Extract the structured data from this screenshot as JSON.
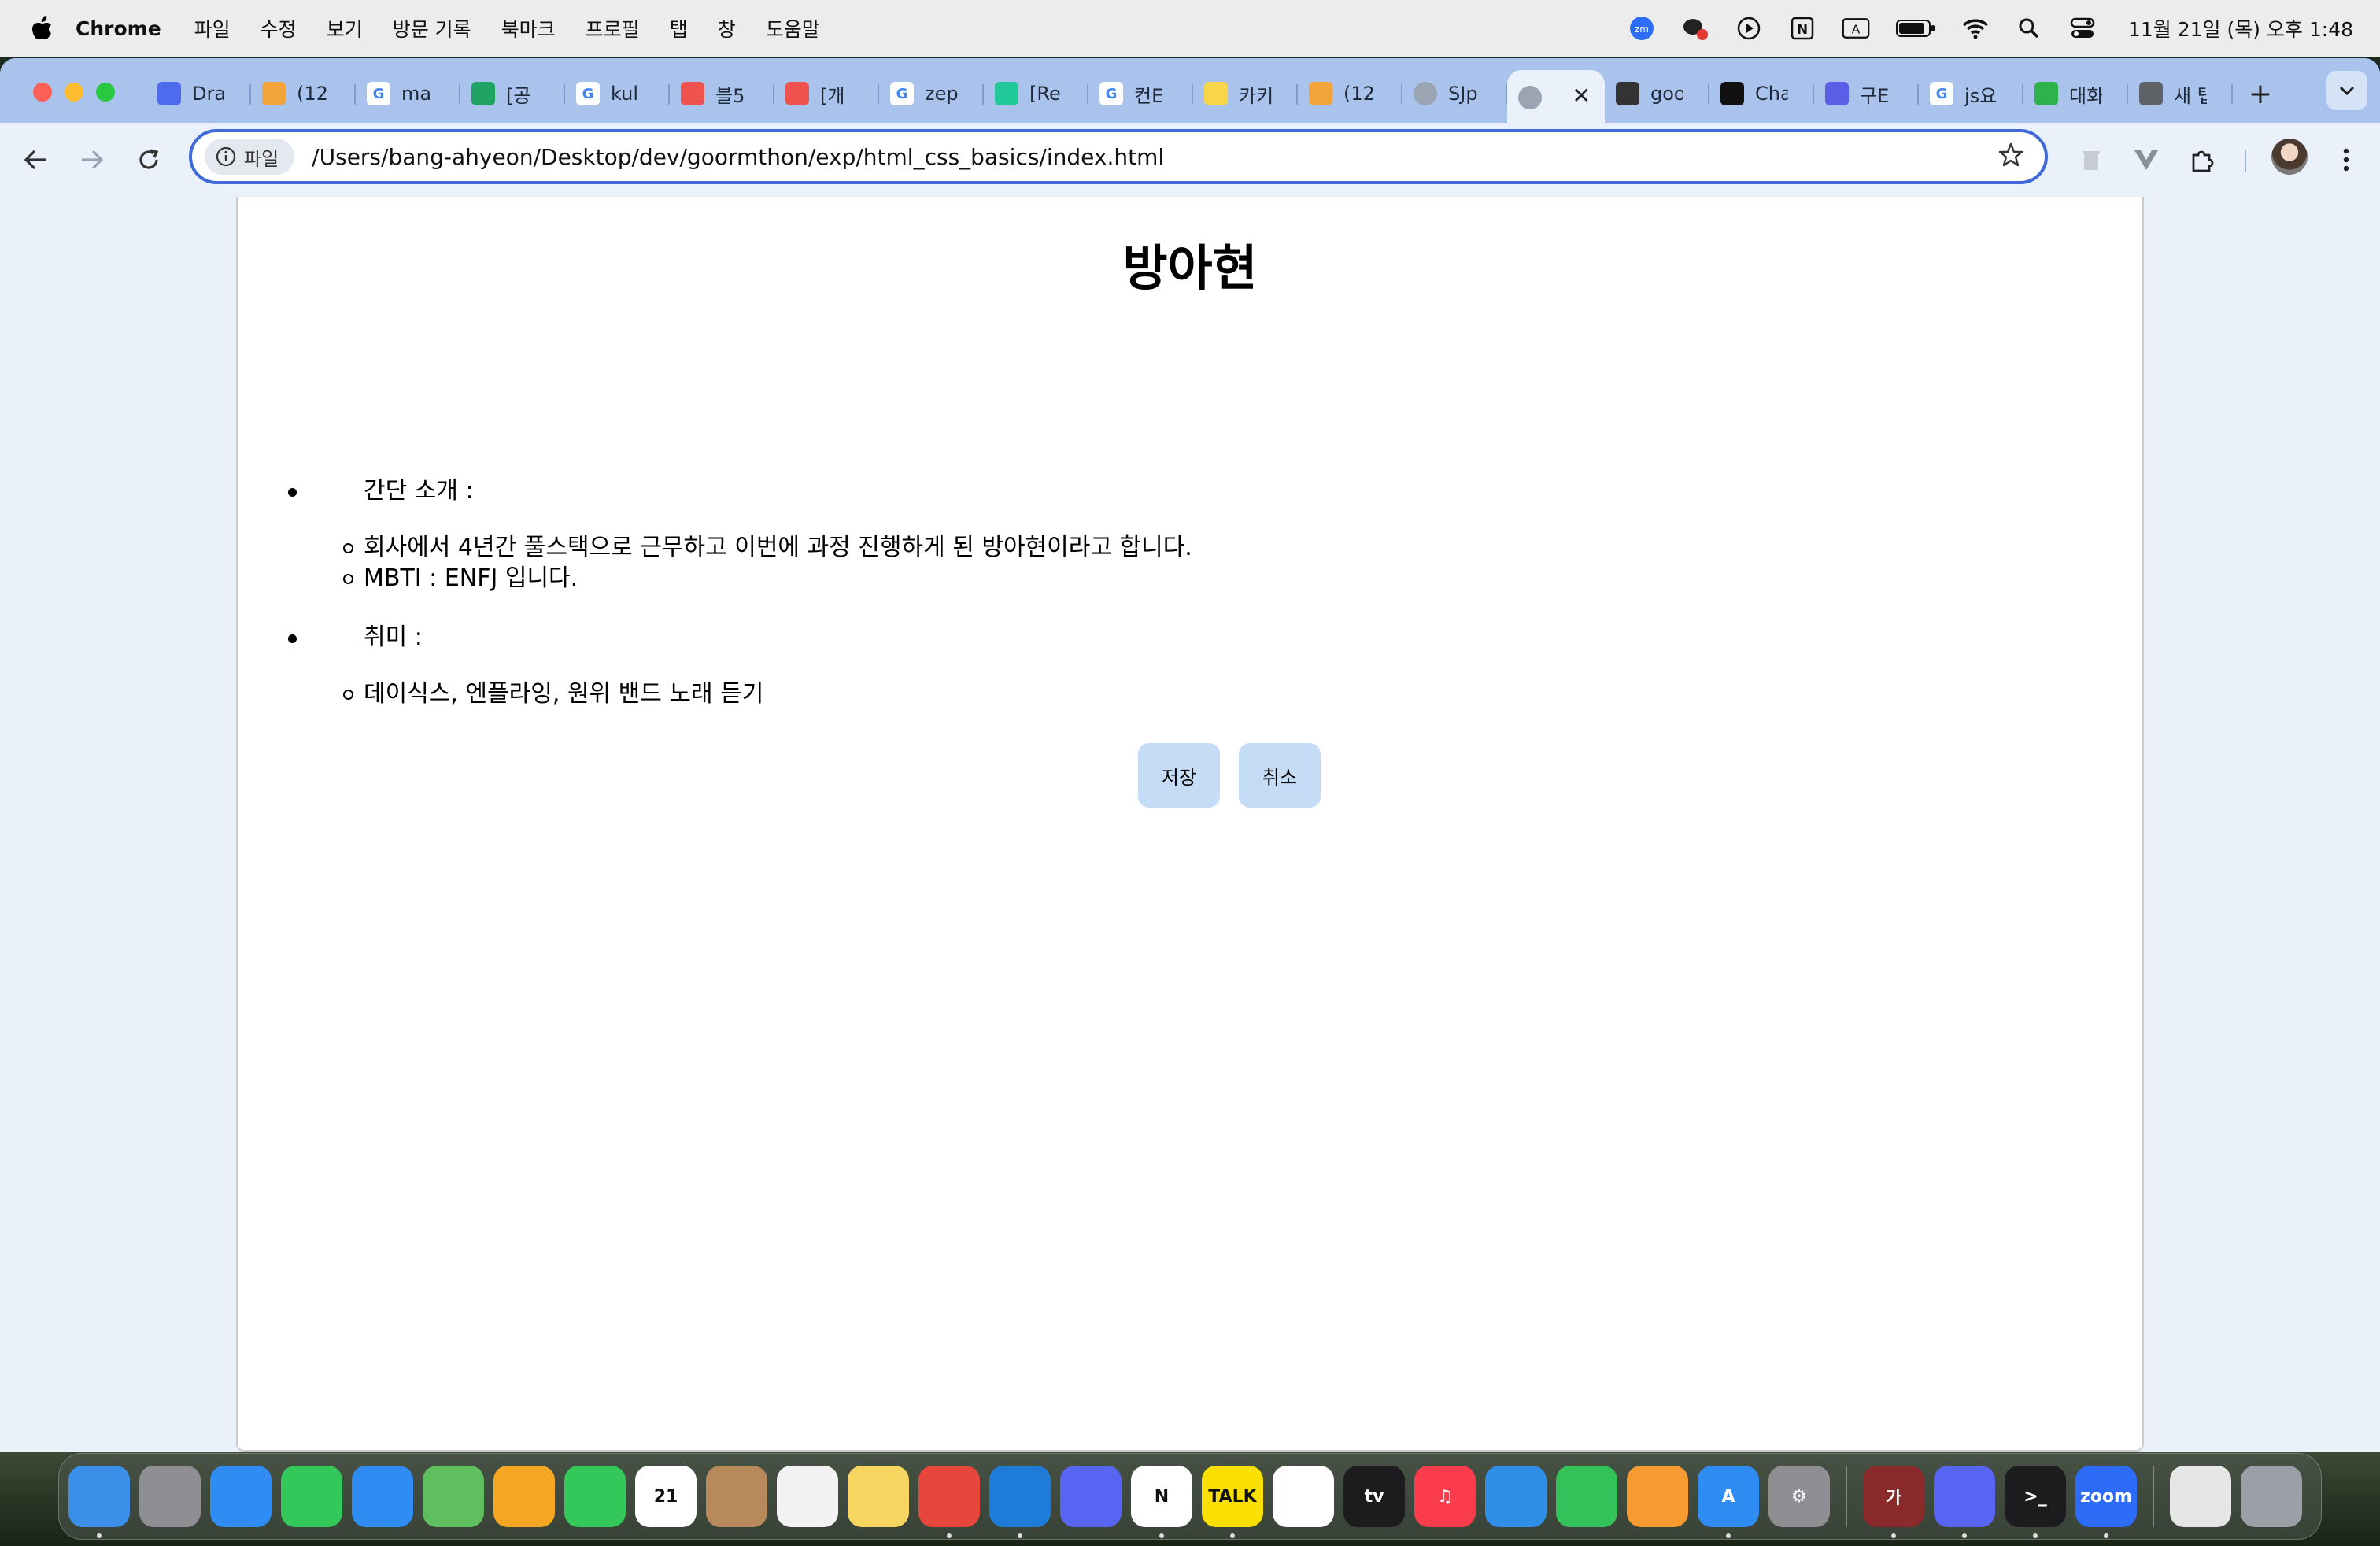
{
  "menubar": {
    "app": "Chrome",
    "items": [
      "파일",
      "수정",
      "보기",
      "방문 기록",
      "북마크",
      "프로필",
      "탭",
      "창",
      "도움말"
    ],
    "clock": "11월 21일 (목) 오후 1:48"
  },
  "tabs": [
    {
      "title": "Dra",
      "icon": "draw-icon",
      "color": "#4f6bed"
    },
    {
      "title": "(12",
      "icon": "emoji-icon",
      "color": "#f2a33a"
    },
    {
      "title": "ma",
      "icon": "google-icon",
      "color": "#4285f4"
    },
    {
      "title": "[공",
      "icon": "plus-icon",
      "color": "#1fa463"
    },
    {
      "title": "kul",
      "icon": "google-icon",
      "color": "#4285f4"
    },
    {
      "title": "블5",
      "icon": "tistory-icon",
      "color": "#ef5350"
    },
    {
      "title": "[개",
      "icon": "tistory-icon",
      "color": "#ef5350"
    },
    {
      "title": "zep",
      "icon": "google-icon",
      "color": "#4285f4"
    },
    {
      "title": "[Re",
      "icon": "velog-icon",
      "color": "#20c997"
    },
    {
      "title": "컨E",
      "icon": "google-icon",
      "color": "#4285f4"
    },
    {
      "title": "카키",
      "icon": "kakao-icon",
      "color": "#f7d64a"
    },
    {
      "title": "(12",
      "icon": "emoji-icon",
      "color": "#f2a33a"
    },
    {
      "title": "SJp",
      "icon": "globe-icon",
      "color": "#9aa4b2"
    },
    {
      "title": "",
      "icon": "globe-icon",
      "color": "#9aa4b2",
      "active": true
    },
    {
      "title": "goo",
      "icon": "monitor-icon",
      "color": "#333333"
    },
    {
      "title": "Cha",
      "icon": "chatgpt-icon",
      "color": "#111111"
    },
    {
      "title": "구E",
      "icon": "goorm-icon",
      "color": "#5a5ee6"
    },
    {
      "title": "js요",
      "icon": "google-icon",
      "color": "#4285f4"
    },
    {
      "title": "대화",
      "icon": "chat-icon",
      "color": "#2db34a"
    },
    {
      "title": "새 탭",
      "icon": "chrome-icon",
      "color": "#5f6368"
    }
  ],
  "toolbar": {
    "chip_label": "파일",
    "url": "/Users/bang-ahyeon/Desktop/dev/goormthon/exp/html_css_basics/index.html"
  },
  "page": {
    "title": "방아현",
    "sections": [
      {
        "label": "간단 소개 :",
        "items": [
          "회사에서 4년간 풀스택으로 근무하고 이번에 과정 진행하게 된 방아현이라고 합니다.",
          "MBTI : ENFJ 입니다."
        ]
      },
      {
        "label": "취미 :",
        "items": [
          "데이식스, 엔플라잉, 원위 밴드 노래 듣기"
        ]
      }
    ],
    "save_label": "저장",
    "cancel_label": "취소"
  },
  "dock": [
    {
      "name": "finder-icon",
      "color": "#3b8fe8",
      "run": true,
      "label": ""
    },
    {
      "name": "launchpad-icon",
      "color": "#8e8e93",
      "run": false,
      "label": ""
    },
    {
      "name": "safari-icon",
      "color": "#2f8cf2",
      "run": false,
      "label": ""
    },
    {
      "name": "messages-icon",
      "color": "#34c759",
      "run": false,
      "label": ""
    },
    {
      "name": "mail-icon",
      "color": "#2f8cf2",
      "run": false,
      "label": ""
    },
    {
      "name": "maps-icon",
      "color": "#5fbf5f",
      "run": false,
      "label": ""
    },
    {
      "name": "photos-icon",
      "color": "#f5a623",
      "run": false,
      "label": ""
    },
    {
      "name": "facetime-icon",
      "color": "#34c759",
      "run": false,
      "label": ""
    },
    {
      "name": "calendar-icon",
      "color": "#ffffff",
      "run": false,
      "label": "21"
    },
    {
      "name": "contacts-icon",
      "color": "#b8895a",
      "run": false,
      "label": ""
    },
    {
      "name": "reminders-icon",
      "color": "#f2f2f2",
      "run": false,
      "label": ""
    },
    {
      "name": "notes-icon",
      "color": "#f7d560",
      "run": false,
      "label": ""
    },
    {
      "name": "chrome-icon",
      "color": "#e8453c",
      "run": true,
      "label": ""
    },
    {
      "name": "vscode-icon",
      "color": "#1f7bd8",
      "run": true,
      "label": ""
    },
    {
      "name": "discord-icon",
      "color": "#5865f2",
      "run": false,
      "label": ""
    },
    {
      "name": "notion-icon",
      "color": "#ffffff",
      "run": true,
      "label": "N"
    },
    {
      "name": "kakaotalk-icon",
      "color": "#f9e000",
      "run": true,
      "label": "TALK"
    },
    {
      "name": "freeform-icon",
      "color": "#ffffff",
      "run": false,
      "label": ""
    },
    {
      "name": "appletv-icon",
      "color": "#1c1c1e",
      "run": false,
      "label": "tv"
    },
    {
      "name": "music-icon",
      "color": "#fa3c4c",
      "run": false,
      "label": "♫"
    },
    {
      "name": "keynote-icon",
      "color": "#2e8ee8",
      "run": false,
      "label": ""
    },
    {
      "name": "numbers-icon",
      "color": "#33c25a",
      "run": false,
      "label": ""
    },
    {
      "name": "pages-icon",
      "color": "#f79a2f",
      "run": false,
      "label": ""
    },
    {
      "name": "appstore-icon",
      "color": "#2f8cf2",
      "run": true,
      "label": "A"
    },
    {
      "name": "settings-icon",
      "color": "#8e8e93",
      "run": false,
      "label": "⚙"
    },
    {
      "name": "sep",
      "color": "",
      "run": false,
      "label": ""
    },
    {
      "name": "dictionary-icon",
      "color": "#8a2a2a",
      "run": true,
      "label": "가"
    },
    {
      "name": "discord-icon",
      "color": "#5865f2",
      "run": true,
      "label": ""
    },
    {
      "name": "terminal-icon",
      "color": "#1c1c1e",
      "run": true,
      "label": ">_"
    },
    {
      "name": "zoom-icon",
      "color": "#2d6cf6",
      "run": true,
      "label": "zoom"
    },
    {
      "name": "sep",
      "color": "",
      "run": false,
      "label": ""
    },
    {
      "name": "document-icon",
      "color": "#e6e6e6",
      "run": false,
      "label": ""
    },
    {
      "name": "trash-icon",
      "color": "#9aa0a6",
      "run": false,
      "label": ""
    }
  ]
}
